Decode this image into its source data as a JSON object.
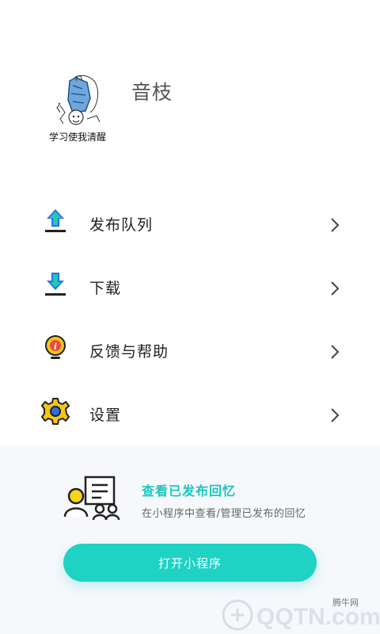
{
  "profile": {
    "avatar_caption": "学习使我清醒",
    "username": "音枝"
  },
  "menu": {
    "items": [
      {
        "label": "发布队列",
        "icon": "upload-icon"
      },
      {
        "label": "下载",
        "icon": "download-icon"
      },
      {
        "label": "反馈与帮助",
        "icon": "help-bulb-icon"
      },
      {
        "label": "设置",
        "icon": "gear-icon"
      }
    ]
  },
  "promo": {
    "title": "查看已发布回忆",
    "subtitle": "在小程序中查看/管理已发布的回忆",
    "button_label": "打开小程序"
  },
  "watermark": {
    "site": "腾牛网",
    "logo_text": "QQTN.com"
  },
  "colors": {
    "accent": "#1ed2c4",
    "promo_title": "#1bc5bf",
    "icon_blue": "#2b6fe0",
    "icon_teal": "#1fc9b7",
    "icon_yellow": "#f5c518",
    "promo_bg": "#f6f8fc"
  }
}
